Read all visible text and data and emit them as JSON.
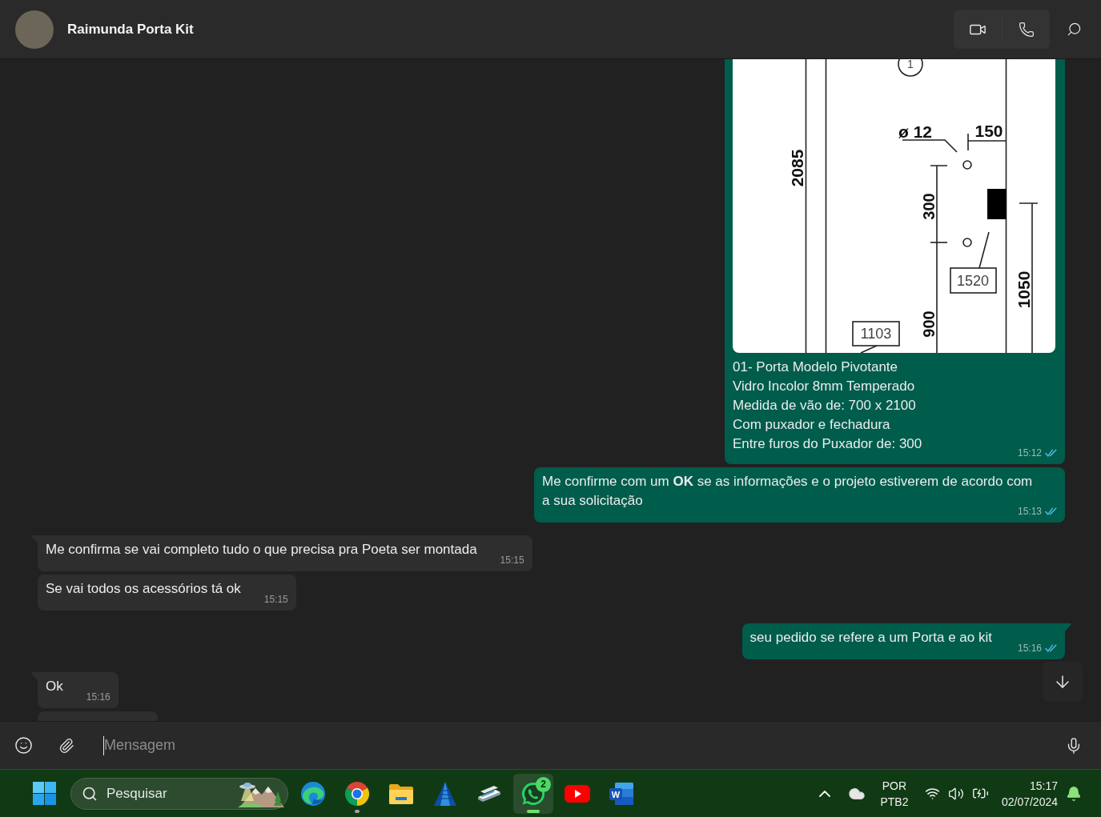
{
  "header": {
    "contact_name": "Raimunda Porta Kit"
  },
  "messages": [
    {
      "kind": "image",
      "outgoing": true,
      "drawing_labels": [
        "1",
        "2085",
        "ø 12",
        "150",
        "300",
        "1520",
        "1050",
        "900",
        "1103"
      ],
      "caption": "01- Porta Modelo Pivotante\nVidro Incolor 8mm Temperado\nMedida de vão de: 700 x 2100\nCom puxador e fechadura\nEntre furos do Puxador de: 300",
      "time": "15:12",
      "read": true
    },
    {
      "kind": "text",
      "outgoing": true,
      "text": "Me confirme com um **OK** se as informações e o projeto estiverem de acordo com a sua solicitação",
      "time": "15:13",
      "read": true,
      "tail": false
    },
    {
      "kind": "text",
      "outgoing": false,
      "text": "Me confirma se vai completo tudo o que precisa pra Poeta ser montada",
      "time": "15:15",
      "tail": true
    },
    {
      "kind": "text",
      "outgoing": false,
      "text": "Se vai todos os acessórios tá ok",
      "time": "15:15",
      "tail": false
    },
    {
      "kind": "text",
      "outgoing": true,
      "text": "seu pedido se refere a um Porta e ao kit",
      "time": "15:16",
      "read": true,
      "tail": true
    },
    {
      "kind": "text",
      "outgoing": false,
      "text": "Ok",
      "time": "15:16",
      "tail": true
    },
    {
      "kind": "clipped",
      "outgoing": false
    }
  ],
  "composer": {
    "placeholder": "Mensagem",
    "focused": true
  },
  "taskbar": {
    "search": {
      "label": "Pesquisar"
    },
    "apps": [
      {
        "kind": "edge",
        "selected": false,
        "running": false
      },
      {
        "kind": "chrome",
        "selected": false,
        "running": true
      },
      {
        "kind": "files",
        "selected": false,
        "running": false
      },
      {
        "kind": "pyramid",
        "selected": false,
        "running": false
      },
      {
        "kind": "scanner",
        "selected": false,
        "running": false
      },
      {
        "kind": "whatsapp",
        "selected": true,
        "running": true,
        "badge": "2"
      },
      {
        "kind": "youtube",
        "selected": false,
        "running": false
      },
      {
        "kind": "word",
        "selected": false,
        "running": false,
        "glyph": "W"
      }
    ],
    "tray": {
      "language": "POR",
      "keyboard": "PTB2",
      "time": "15:17",
      "date": "02/07/2024"
    }
  }
}
